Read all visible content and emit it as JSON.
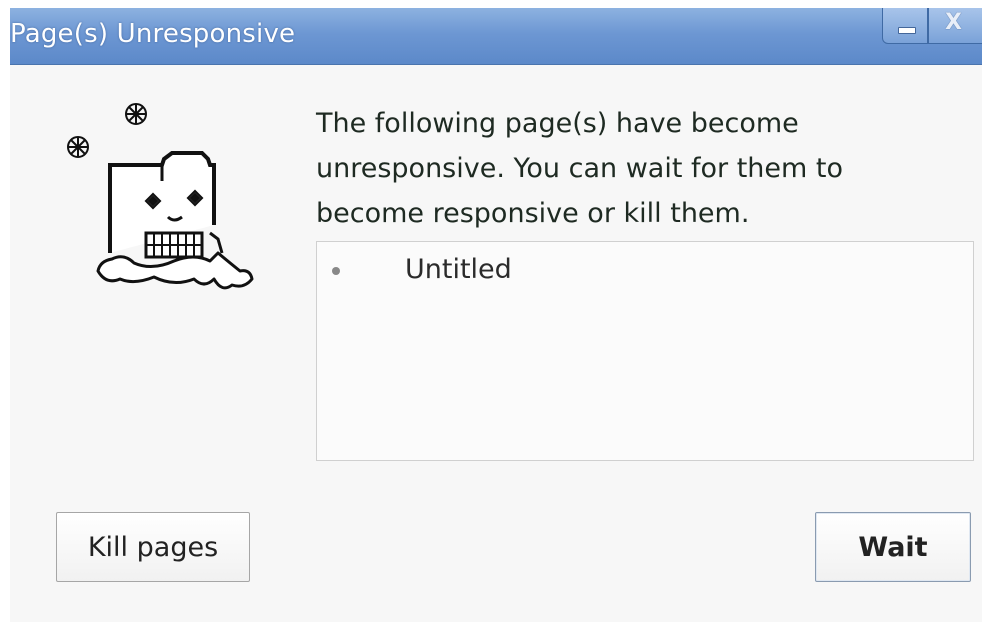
{
  "window": {
    "title": "Page(s) Unresponsive",
    "controls": {
      "minimize": "minimize-icon",
      "close": "close-icon",
      "close_glyph": "X"
    }
  },
  "illustration": {
    "icon": "frozen-tab-icon"
  },
  "message": "The following page(s) have become unresponsive. You can wait for them to become responsive or kill them.",
  "pages": [
    {
      "title": "Untitled"
    }
  ],
  "buttons": {
    "kill": "Kill pages",
    "wait": "Wait"
  },
  "colors": {
    "titlebar": "#6d97d3",
    "background": "#f7f7f7",
    "text": "#1e2a22"
  }
}
